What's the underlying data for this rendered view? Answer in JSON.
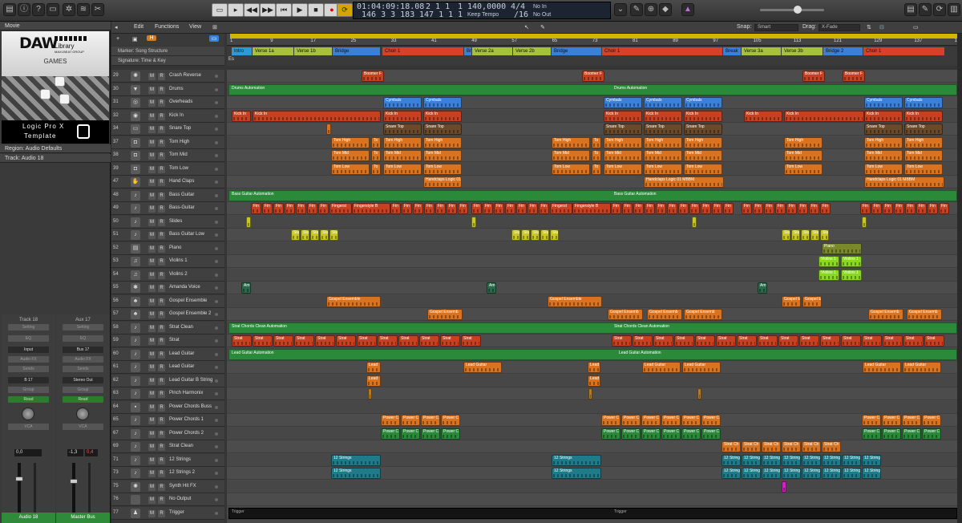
{
  "control_bar": {
    "lcd": {
      "smpte": "01:04:09:18.08",
      "bars": "146 3 3 183",
      "loc1": "2 1 1",
      "loc1b": "1",
      "loc2": "147 1 1",
      "loc2b": "1",
      "tempo": "140,0000",
      "tempo_mode": "Keep Tempo",
      "sig_top": "4/4",
      "sig_bot": "/16",
      "in": "No In",
      "out": "No Out"
    }
  },
  "inspector": {
    "movie_label": "Movie",
    "logo_main": "DAW",
    "logo_lib": "Library",
    "logo_sub": "MAXI-BEAT GROUP",
    "games": "GAMES",
    "caption1": "Logic Pro X",
    "caption2": "Template",
    "region_label": "Region: Audio Defaults",
    "track_label": "Track: Audio 18",
    "strip1": {
      "name": "Track 18",
      "setting": "Setting",
      "eq": "EQ",
      "input": "Input",
      "audio_fx": "Audio FX",
      "sends": "Sends",
      "io": "B 17",
      "group": "Group",
      "auto": "Read",
      "pan": "VCA",
      "vol": "0,0",
      "footer": "Audio 18"
    },
    "strip2": {
      "name": "Aux 17",
      "setting": "Setting",
      "eq": "EQ",
      "input": "Bus 17",
      "audio_fx": "Audio FX",
      "sends": "Sends",
      "io": "Stereo Out",
      "group": "Group",
      "auto": "Read",
      "pan": "VCA",
      "vol": "-1,3",
      "vol2": "0,4",
      "footer": "Master Bus"
    },
    "btn_m": "M",
    "btn_s": "S"
  },
  "tracks_toolbar": {
    "edit": "Edit",
    "functions": "Functions",
    "view": "View",
    "snap_label": "Snap:",
    "snap_value": "Smart",
    "drag_label": "Drag:",
    "drag_value": "X-Fade"
  },
  "ruler": [
    "1",
    "9",
    "17",
    "25",
    "33",
    "41",
    "49",
    "57",
    "65",
    "73",
    "81",
    "89",
    "97",
    "105",
    "113",
    "121",
    "129",
    "137",
    "145"
  ],
  "global_tracks": {
    "marker_label": "Marker: Song Structure",
    "signature_label": "Signature: Time & Key",
    "signature_key": "Es"
  },
  "markers": [
    {
      "label": "Intro",
      "color": "#2a9bd8"
    },
    {
      "label": "Verse 1a",
      "color": "#a6c23a"
    },
    {
      "label": "Verse 1b",
      "color": "#a6c23a"
    },
    {
      "label": "Bridge",
      "color": "#3a7fd8"
    },
    {
      "label": "Choir 1",
      "color": "#d8402a"
    },
    {
      "label": "Br",
      "color": "#3a7fd8"
    },
    {
      "label": "Verse 2a",
      "color": "#a6c23a"
    },
    {
      "label": "Verse 2b",
      "color": "#a6c23a"
    },
    {
      "label": "Bridge",
      "color": "#3a7fd8"
    },
    {
      "label": "Choir 1",
      "color": "#d8402a"
    },
    {
      "label": "Break",
      "color": "#3a7fd8"
    },
    {
      "label": "Verse 3a",
      "color": "#a6c23a"
    },
    {
      "label": "Verse 3b",
      "color": "#a6c23a"
    },
    {
      "label": "Bridge 2",
      "color": "#3a7fd8"
    },
    {
      "label": "Choir 1",
      "color": "#d8402a"
    }
  ],
  "btn_m": "M",
  "btn_r": "R",
  "tracks": [
    {
      "num": "29",
      "name": "Crash Reverse",
      "icon": "✺"
    },
    {
      "num": "30",
      "name": "Drums",
      "icon": "▼"
    },
    {
      "num": "31",
      "name": "Overheads",
      "icon": "◎"
    },
    {
      "num": "32",
      "name": "Kick In",
      "icon": "◉"
    },
    {
      "num": "34",
      "name": "Snare Top",
      "icon": "▭"
    },
    {
      "num": "37",
      "name": "Tom High",
      "icon": "◘"
    },
    {
      "num": "38",
      "name": "Tom Mid",
      "icon": "◘"
    },
    {
      "num": "39",
      "name": "Tom Low",
      "icon": "◘"
    },
    {
      "num": "47",
      "name": "Hand Claps",
      "icon": "✋"
    },
    {
      "num": "48",
      "name": "Bass Guitar",
      "icon": "♪"
    },
    {
      "num": "49",
      "name": "Bass-Guitar",
      "icon": "♪"
    },
    {
      "num": "50",
      "name": "Slides",
      "icon": "♪"
    },
    {
      "num": "51",
      "name": "Bass Guitar Low",
      "icon": "♪"
    },
    {
      "num": "52",
      "name": "Piano",
      "icon": "▤"
    },
    {
      "num": "53",
      "name": "Violins 1",
      "icon": "♫"
    },
    {
      "num": "54",
      "name": "Violins 2",
      "icon": "♫"
    },
    {
      "num": "55",
      "name": "Amanda Voice",
      "icon": "✱"
    },
    {
      "num": "56",
      "name": "Gospel Ensemble",
      "icon": "♣"
    },
    {
      "num": "57",
      "name": "Gospel Ensemble 2",
      "icon": "♣"
    },
    {
      "num": "58",
      "name": "Strat Clean",
      "icon": "♪"
    },
    {
      "num": "59",
      "name": "Strat",
      "icon": "♪"
    },
    {
      "num": "60",
      "name": "Lead Guitar",
      "icon": "♪"
    },
    {
      "num": "61",
      "name": "Lead Guitar",
      "icon": "♪"
    },
    {
      "num": "62",
      "name": "Lead Guitar B String",
      "icon": "♪"
    },
    {
      "num": "63",
      "name": "Pinch Harmonix",
      "icon": "♪"
    },
    {
      "num": "64",
      "name": "Power Chords Buss",
      "icon": "▪"
    },
    {
      "num": "65",
      "name": "Power Chords 1",
      "icon": "♪"
    },
    {
      "num": "67",
      "name": "Power Chords 2",
      "icon": "♪"
    },
    {
      "num": "69",
      "name": "Strat Clean",
      "icon": "♪"
    },
    {
      "num": "71",
      "name": "12 Strings",
      "icon": "♪"
    },
    {
      "num": "73",
      "name": "12 Strings 2",
      "icon": "♪"
    },
    {
      "num": "75",
      "name": "Synth Hit FX",
      "icon": "✺"
    },
    {
      "num": "76",
      "name": "No Output",
      "icon": ""
    },
    {
      "num": "77",
      "name": "Trigger",
      "icon": "♟"
    }
  ],
  "automation_labels": {
    "drums": "Drums Automation",
    "bass": "Bass Guitar Automation",
    "strat": "Strat Chords Clean Automation",
    "lead": "Lead Guitar Automation",
    "trigger": "Trigger"
  },
  "region_labels": {
    "boomer": "Boomer F",
    "cymbals": "Cymbals",
    "kick": "Kick In",
    "snare": "Snare Top",
    "tom_high": "Tom High",
    "tom_mid": "Tom Mid",
    "tom_low": "Tom Low",
    "to": "To",
    "handclaps": "Handclaps Logic 01 MBBM",
    "fin": "Fin",
    "fingerst": "Fingerst",
    "fingerstyle": "Fingerstyle B",
    "slides": "Slu",
    "piano": "Piano",
    "violins1": "Violins 1",
    "violins2": "Violins 1",
    "amanda": "Am",
    "gospel": "Gospel Ensemble",
    "gospel_short": "Gospel Ensemb",
    "gospel_e": "Gospel E",
    "strat": "Strat",
    "lead": "Lead Guitar",
    "lead_short": "Lead",
    "power": "Power C",
    "stratch": "Strat Ch",
    "strings": "12 Strings",
    "strings_short": "12 String"
  },
  "colors": {
    "orange": "#d9731f",
    "red": "#c8401f",
    "blue": "#3a7fd8",
    "green": "#2a8a3a",
    "yellow": "#c8c81f",
    "lime": "#8ad81f",
    "teal": "#1f7a8a",
    "olive": "#7a8a2a",
    "magenta": "#d81fc8"
  }
}
